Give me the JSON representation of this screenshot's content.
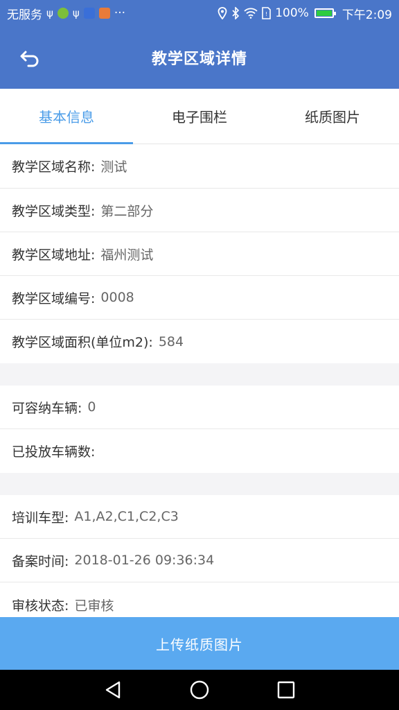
{
  "status_bar": {
    "carrier": "无服务",
    "more": "···",
    "battery": "100%",
    "time": "下午2:09",
    "icons": [
      "usb-icon",
      "app-icon",
      "usb-icon",
      "app-icon",
      "app-icon",
      "location-icon",
      "bluetooth-icon",
      "wifi-icon",
      "sim-icon",
      "battery-icon"
    ]
  },
  "header": {
    "title": "教学区域详情",
    "back_icon": "back-icon"
  },
  "tabs": [
    {
      "label": "基本信息",
      "active": true
    },
    {
      "label": "电子围栏",
      "active": false
    },
    {
      "label": "纸质图片",
      "active": false
    }
  ],
  "fields": {
    "name": {
      "label": "教学区域名称:",
      "value": "测试"
    },
    "type": {
      "label": "教学区域类型:",
      "value": "第二部分"
    },
    "address": {
      "label": "教学区域地址:",
      "value": "福州测试"
    },
    "number": {
      "label": "教学区域编号:",
      "value": "0008"
    },
    "area": {
      "label": "教学区域面积(单位m2):",
      "value": "584"
    },
    "capacity": {
      "label": "可容纳车辆:",
      "value": "0"
    },
    "deployed": {
      "label": "已投放车辆数:",
      "value": ""
    },
    "car_types": {
      "label": "培训车型:",
      "value": "A1,A2,C1,C2,C3"
    },
    "record_time": {
      "label": "备案时间:",
      "value": "2018-01-26 09:36:34"
    },
    "review_status": {
      "label": "审核状态:",
      "value": "已审核"
    }
  },
  "upload_button": "上传纸质图片",
  "colors": {
    "primary": "#4a76c9",
    "tab_active": "#4a9ce8",
    "button": "#5aa9f0"
  }
}
